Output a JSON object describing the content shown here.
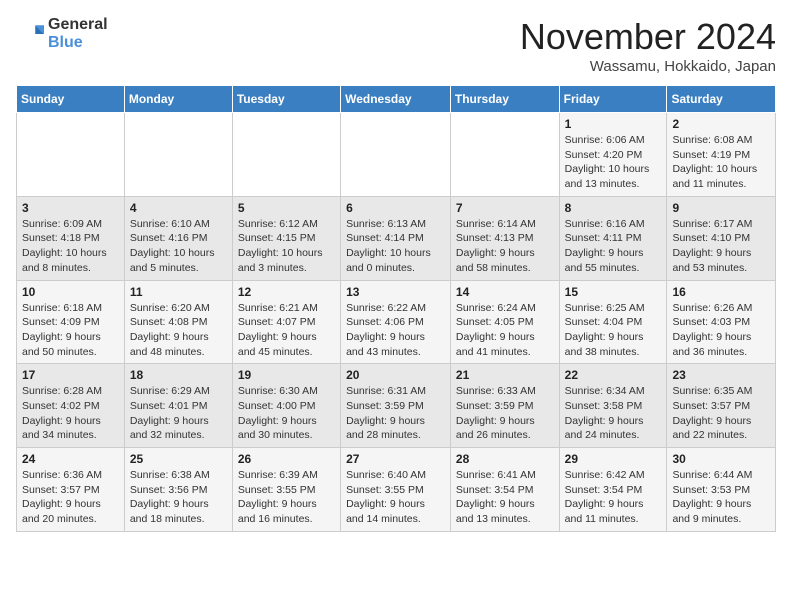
{
  "logo": {
    "line1": "General",
    "line2": "Blue"
  },
  "title": "November 2024",
  "location": "Wassamu, Hokkaido, Japan",
  "days_of_week": [
    "Sunday",
    "Monday",
    "Tuesday",
    "Wednesday",
    "Thursday",
    "Friday",
    "Saturday"
  ],
  "weeks": [
    [
      {
        "day": "",
        "info": ""
      },
      {
        "day": "",
        "info": ""
      },
      {
        "day": "",
        "info": ""
      },
      {
        "day": "",
        "info": ""
      },
      {
        "day": "",
        "info": ""
      },
      {
        "day": "1",
        "info": "Sunrise: 6:06 AM\nSunset: 4:20 PM\nDaylight: 10 hours and 13 minutes."
      },
      {
        "day": "2",
        "info": "Sunrise: 6:08 AM\nSunset: 4:19 PM\nDaylight: 10 hours and 11 minutes."
      }
    ],
    [
      {
        "day": "3",
        "info": "Sunrise: 6:09 AM\nSunset: 4:18 PM\nDaylight: 10 hours and 8 minutes."
      },
      {
        "day": "4",
        "info": "Sunrise: 6:10 AM\nSunset: 4:16 PM\nDaylight: 10 hours and 5 minutes."
      },
      {
        "day": "5",
        "info": "Sunrise: 6:12 AM\nSunset: 4:15 PM\nDaylight: 10 hours and 3 minutes."
      },
      {
        "day": "6",
        "info": "Sunrise: 6:13 AM\nSunset: 4:14 PM\nDaylight: 10 hours and 0 minutes."
      },
      {
        "day": "7",
        "info": "Sunrise: 6:14 AM\nSunset: 4:13 PM\nDaylight: 9 hours and 58 minutes."
      },
      {
        "day": "8",
        "info": "Sunrise: 6:16 AM\nSunset: 4:11 PM\nDaylight: 9 hours and 55 minutes."
      },
      {
        "day": "9",
        "info": "Sunrise: 6:17 AM\nSunset: 4:10 PM\nDaylight: 9 hours and 53 minutes."
      }
    ],
    [
      {
        "day": "10",
        "info": "Sunrise: 6:18 AM\nSunset: 4:09 PM\nDaylight: 9 hours and 50 minutes."
      },
      {
        "day": "11",
        "info": "Sunrise: 6:20 AM\nSunset: 4:08 PM\nDaylight: 9 hours and 48 minutes."
      },
      {
        "day": "12",
        "info": "Sunrise: 6:21 AM\nSunset: 4:07 PM\nDaylight: 9 hours and 45 minutes."
      },
      {
        "day": "13",
        "info": "Sunrise: 6:22 AM\nSunset: 4:06 PM\nDaylight: 9 hours and 43 minutes."
      },
      {
        "day": "14",
        "info": "Sunrise: 6:24 AM\nSunset: 4:05 PM\nDaylight: 9 hours and 41 minutes."
      },
      {
        "day": "15",
        "info": "Sunrise: 6:25 AM\nSunset: 4:04 PM\nDaylight: 9 hours and 38 minutes."
      },
      {
        "day": "16",
        "info": "Sunrise: 6:26 AM\nSunset: 4:03 PM\nDaylight: 9 hours and 36 minutes."
      }
    ],
    [
      {
        "day": "17",
        "info": "Sunrise: 6:28 AM\nSunset: 4:02 PM\nDaylight: 9 hours and 34 minutes."
      },
      {
        "day": "18",
        "info": "Sunrise: 6:29 AM\nSunset: 4:01 PM\nDaylight: 9 hours and 32 minutes."
      },
      {
        "day": "19",
        "info": "Sunrise: 6:30 AM\nSunset: 4:00 PM\nDaylight: 9 hours and 30 minutes."
      },
      {
        "day": "20",
        "info": "Sunrise: 6:31 AM\nSunset: 3:59 PM\nDaylight: 9 hours and 28 minutes."
      },
      {
        "day": "21",
        "info": "Sunrise: 6:33 AM\nSunset: 3:59 PM\nDaylight: 9 hours and 26 minutes."
      },
      {
        "day": "22",
        "info": "Sunrise: 6:34 AM\nSunset: 3:58 PM\nDaylight: 9 hours and 24 minutes."
      },
      {
        "day": "23",
        "info": "Sunrise: 6:35 AM\nSunset: 3:57 PM\nDaylight: 9 hours and 22 minutes."
      }
    ],
    [
      {
        "day": "24",
        "info": "Sunrise: 6:36 AM\nSunset: 3:57 PM\nDaylight: 9 hours and 20 minutes."
      },
      {
        "day": "25",
        "info": "Sunrise: 6:38 AM\nSunset: 3:56 PM\nDaylight: 9 hours and 18 minutes."
      },
      {
        "day": "26",
        "info": "Sunrise: 6:39 AM\nSunset: 3:55 PM\nDaylight: 9 hours and 16 minutes."
      },
      {
        "day": "27",
        "info": "Sunrise: 6:40 AM\nSunset: 3:55 PM\nDaylight: 9 hours and 14 minutes."
      },
      {
        "day": "28",
        "info": "Sunrise: 6:41 AM\nSunset: 3:54 PM\nDaylight: 9 hours and 13 minutes."
      },
      {
        "day": "29",
        "info": "Sunrise: 6:42 AM\nSunset: 3:54 PM\nDaylight: 9 hours and 11 minutes."
      },
      {
        "day": "30",
        "info": "Sunrise: 6:44 AM\nSunset: 3:53 PM\nDaylight: 9 hours and 9 minutes."
      }
    ]
  ]
}
